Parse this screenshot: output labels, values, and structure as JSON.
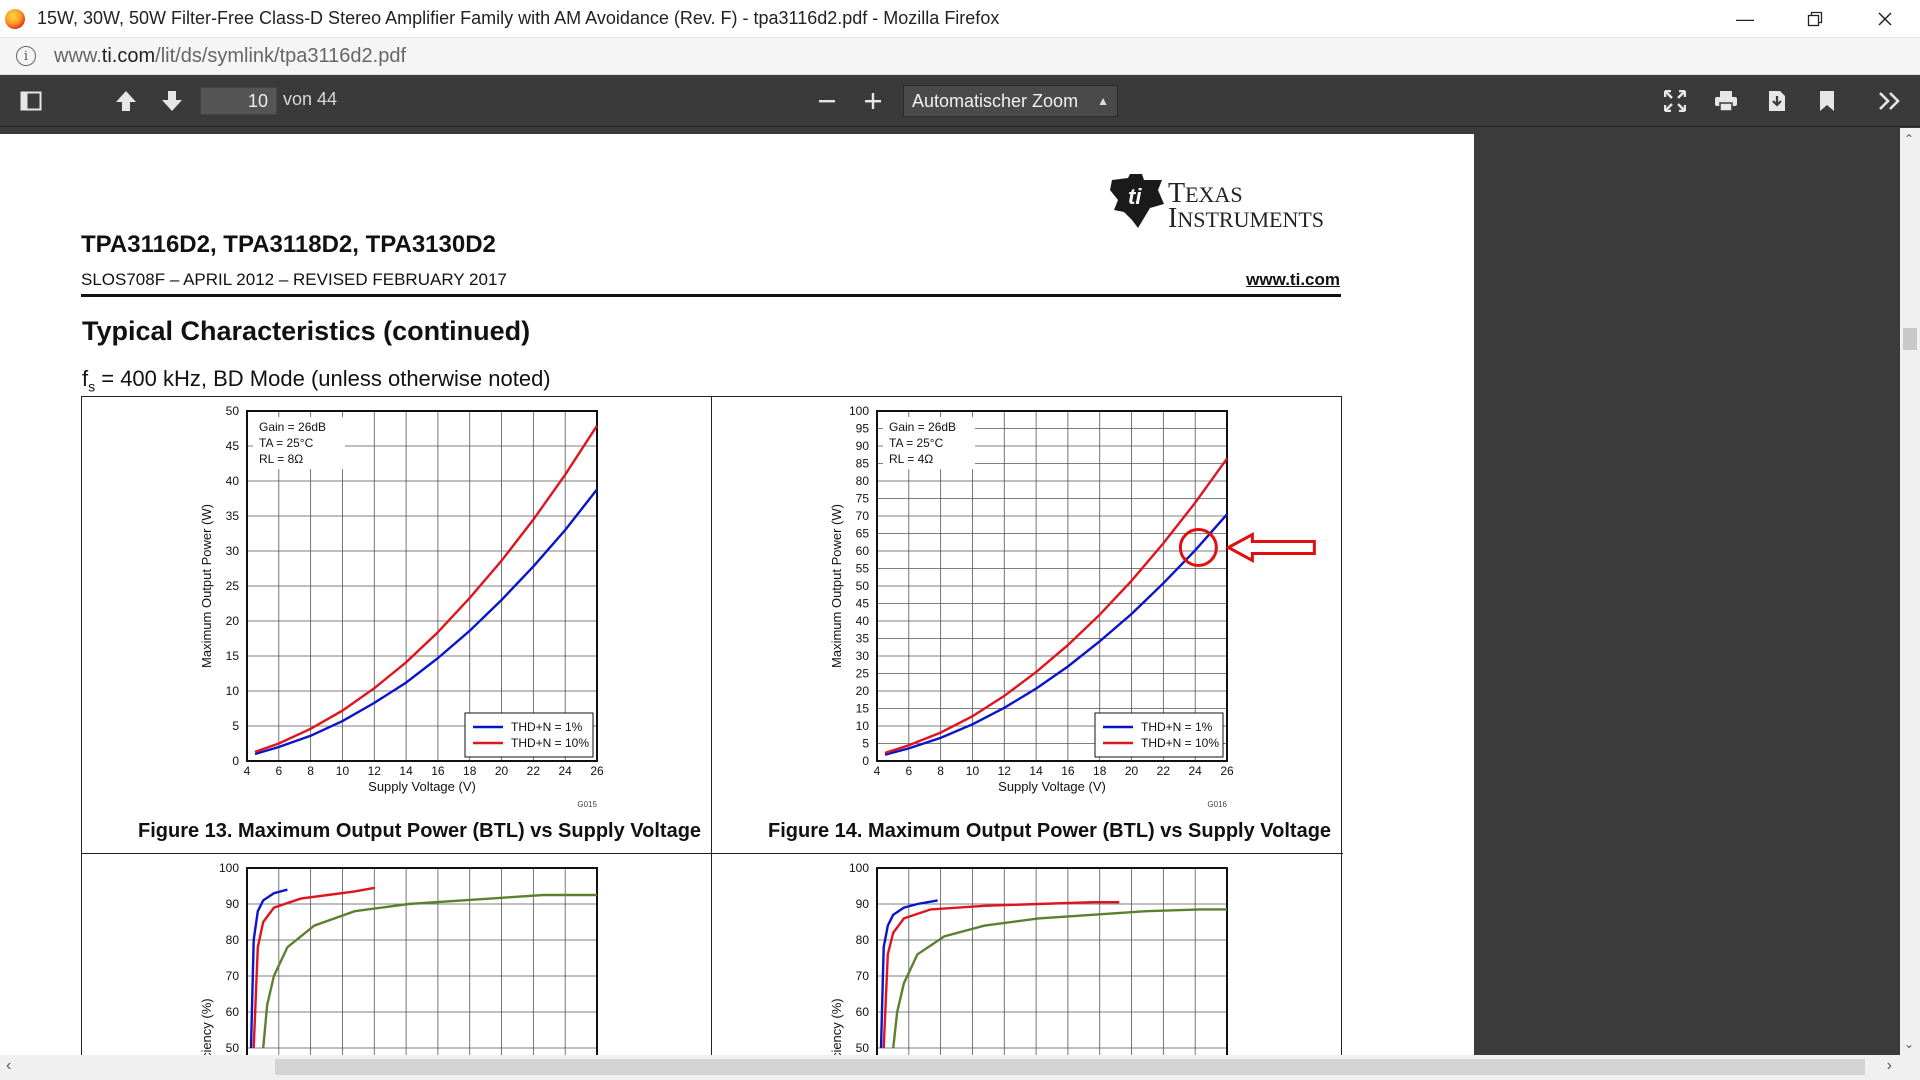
{
  "window": {
    "title": "15W, 30W, 50W Filter-Free Class-D Stereo Amplifier Family with AM Avoidance (Rev. F) - tpa3116d2.pdf - Mozilla Firefox",
    "minimize_icon": "minimize-icon",
    "restore_icon": "restore-icon",
    "close_icon": "close-icon"
  },
  "urlbar": {
    "url_prefix": "www.",
    "url_domain": "ti.com",
    "url_path": "/lit/ds/symlink/tpa3116d2.pdf"
  },
  "toolbar": {
    "page_number": "10",
    "of_pages": "von 44",
    "zoom_label": "Automatischer Zoom",
    "icons": [
      "sidebar-toggle-icon",
      "page-up-icon",
      "page-down-icon",
      "zoom-out-icon",
      "zoom-in-icon",
      "presentation-mode-icon",
      "print-icon",
      "download-icon",
      "bookmark-icon",
      "tools-icon"
    ]
  },
  "doc": {
    "title": "TPA3116D2, TPA3118D2, TPA3130D2",
    "subtitle": "SLOS708F – APRIL 2012 – REVISED FEBRUARY 2017",
    "website": "www.ti.com",
    "logo_line1": "Texas",
    "logo_line2": "Instruments",
    "section_title": "Typical Characteristics (continued)",
    "conditions_f": "f",
    "conditions_sub": "s",
    "conditions_rest": " = 400 kHz, BD Mode (unless otherwise noted)"
  },
  "colors": {
    "thd1": "#0a14c8",
    "thd10": "#e0141e",
    "green": "#5c8030",
    "annotation": "#e01010"
  },
  "chart_data": [
    {
      "type": "line",
      "title": "Figure 13. Maximum Output Power (BTL) vs Supply Voltage",
      "xlabel": "Supply Voltage (V)",
      "ylabel": "Maximum Output Power (W)",
      "xlim": [
        4,
        26
      ],
      "ylim": [
        0,
        50
      ],
      "xticks": [
        4,
        6,
        8,
        10,
        12,
        14,
        16,
        18,
        20,
        22,
        24,
        26
      ],
      "yticks": [
        0,
        5,
        10,
        15,
        20,
        25,
        30,
        35,
        40,
        45,
        50
      ],
      "conditions": [
        "Gain = 26dB",
        "TA = 25°C",
        "RL = 8Ω"
      ],
      "code": "G015",
      "legend_position": "bottom-right",
      "grid": true,
      "series": [
        {
          "name": "THD+N = 1%",
          "x": [
            4.5,
            6,
            8,
            10,
            12,
            14,
            16,
            18,
            20,
            22,
            24,
            26
          ],
          "y": [
            1.0,
            2.0,
            3.6,
            5.7,
            8.3,
            11.2,
            14.7,
            18.6,
            23.0,
            27.8,
            33.0,
            38.8
          ]
        },
        {
          "name": "THD+N = 10%",
          "x": [
            4.5,
            6,
            8,
            10,
            12,
            14,
            16,
            18,
            20,
            22,
            24,
            26
          ],
          "y": [
            1.3,
            2.5,
            4.6,
            7.2,
            10.4,
            14.1,
            18.4,
            23.3,
            28.6,
            34.5,
            40.9,
            47.9
          ]
        }
      ]
    },
    {
      "type": "line",
      "title": "Figure 14. Maximum Output Power (BTL) vs Supply Voltage",
      "xlabel": "Supply Voltage (V)",
      "ylabel": "Maximum Output Power (W)",
      "xlim": [
        4,
        26
      ],
      "ylim": [
        0,
        100
      ],
      "xticks": [
        4,
        6,
        8,
        10,
        12,
        14,
        16,
        18,
        20,
        22,
        24,
        26
      ],
      "yticks": [
        0,
        5,
        10,
        15,
        20,
        25,
        30,
        35,
        40,
        45,
        50,
        55,
        60,
        65,
        70,
        75,
        80,
        85,
        90,
        95,
        100
      ],
      "conditions": [
        "Gain = 26dB",
        "TA = 25°C",
        "RL = 4Ω"
      ],
      "code": "G016",
      "legend_position": "bottom-right",
      "grid": true,
      "series": [
        {
          "name": "THD+N = 1%",
          "x": [
            4.5,
            6,
            8,
            10,
            12,
            14,
            16,
            18,
            20,
            22,
            24,
            26
          ],
          "y": [
            1.8,
            3.6,
            6.6,
            10.5,
            15.2,
            20.7,
            27.0,
            34.2,
            42.0,
            50.8,
            60.2,
            70.5
          ]
        },
        {
          "name": "THD+N = 10%",
          "x": [
            4.5,
            6,
            8,
            10,
            12,
            14,
            16,
            18,
            20,
            22,
            24,
            26
          ],
          "y": [
            2.3,
            4.5,
            8.1,
            12.8,
            18.6,
            25.4,
            33.1,
            41.8,
            51.5,
            62.2,
            73.8,
            86.4
          ]
        }
      ]
    },
    {
      "type": "line",
      "ylabel": "Efficiency (%)",
      "ylim": [
        50,
        100
      ],
      "yticks": [
        50,
        60,
        70,
        80,
        90,
        100
      ],
      "grid": true,
      "series": [
        {
          "x": [
            0.3,
            0.5,
            0.8,
            1.2,
            2,
            3
          ],
          "y": [
            50,
            80,
            88,
            91,
            93,
            94
          ]
        },
        {
          "x": [
            0.5,
            0.8,
            1.2,
            2,
            4,
            6,
            8,
            9.5
          ],
          "y": [
            50,
            78,
            85,
            89,
            91.5,
            92.5,
            93.5,
            94.5
          ]
        },
        {
          "x": [
            1.2,
            1.5,
            2,
            3,
            5,
            8,
            12,
            16,
            20,
            22,
            24,
            26
          ],
          "y": [
            50,
            62,
            70,
            78,
            84,
            88,
            90,
            91,
            92,
            92.5,
            92.5,
            92.5
          ]
        }
      ]
    },
    {
      "type": "line",
      "ylabel": "Efficiency (%)",
      "ylim": [
        50,
        100
      ],
      "yticks": [
        50,
        60,
        70,
        80,
        90,
        100
      ],
      "grid": true,
      "series": [
        {
          "x": [
            0.3,
            0.5,
            0.8,
            1.2,
            2,
            3,
            4.5
          ],
          "y": [
            50,
            78,
            84,
            87,
            89,
            90,
            91
          ]
        },
        {
          "x": [
            0.5,
            0.8,
            1.2,
            2,
            4,
            8,
            12,
            16,
            18
          ],
          "y": [
            50,
            76,
            82,
            86,
            88.5,
            89.5,
            90,
            90.5,
            90.5
          ]
        },
        {
          "x": [
            1.2,
            1.5,
            2,
            3,
            5,
            8,
            12,
            16,
            20,
            24,
            26
          ],
          "y": [
            50,
            60,
            68,
            76,
            81,
            84,
            86,
            87,
            88,
            88.5,
            88.5
          ]
        }
      ]
    }
  ]
}
